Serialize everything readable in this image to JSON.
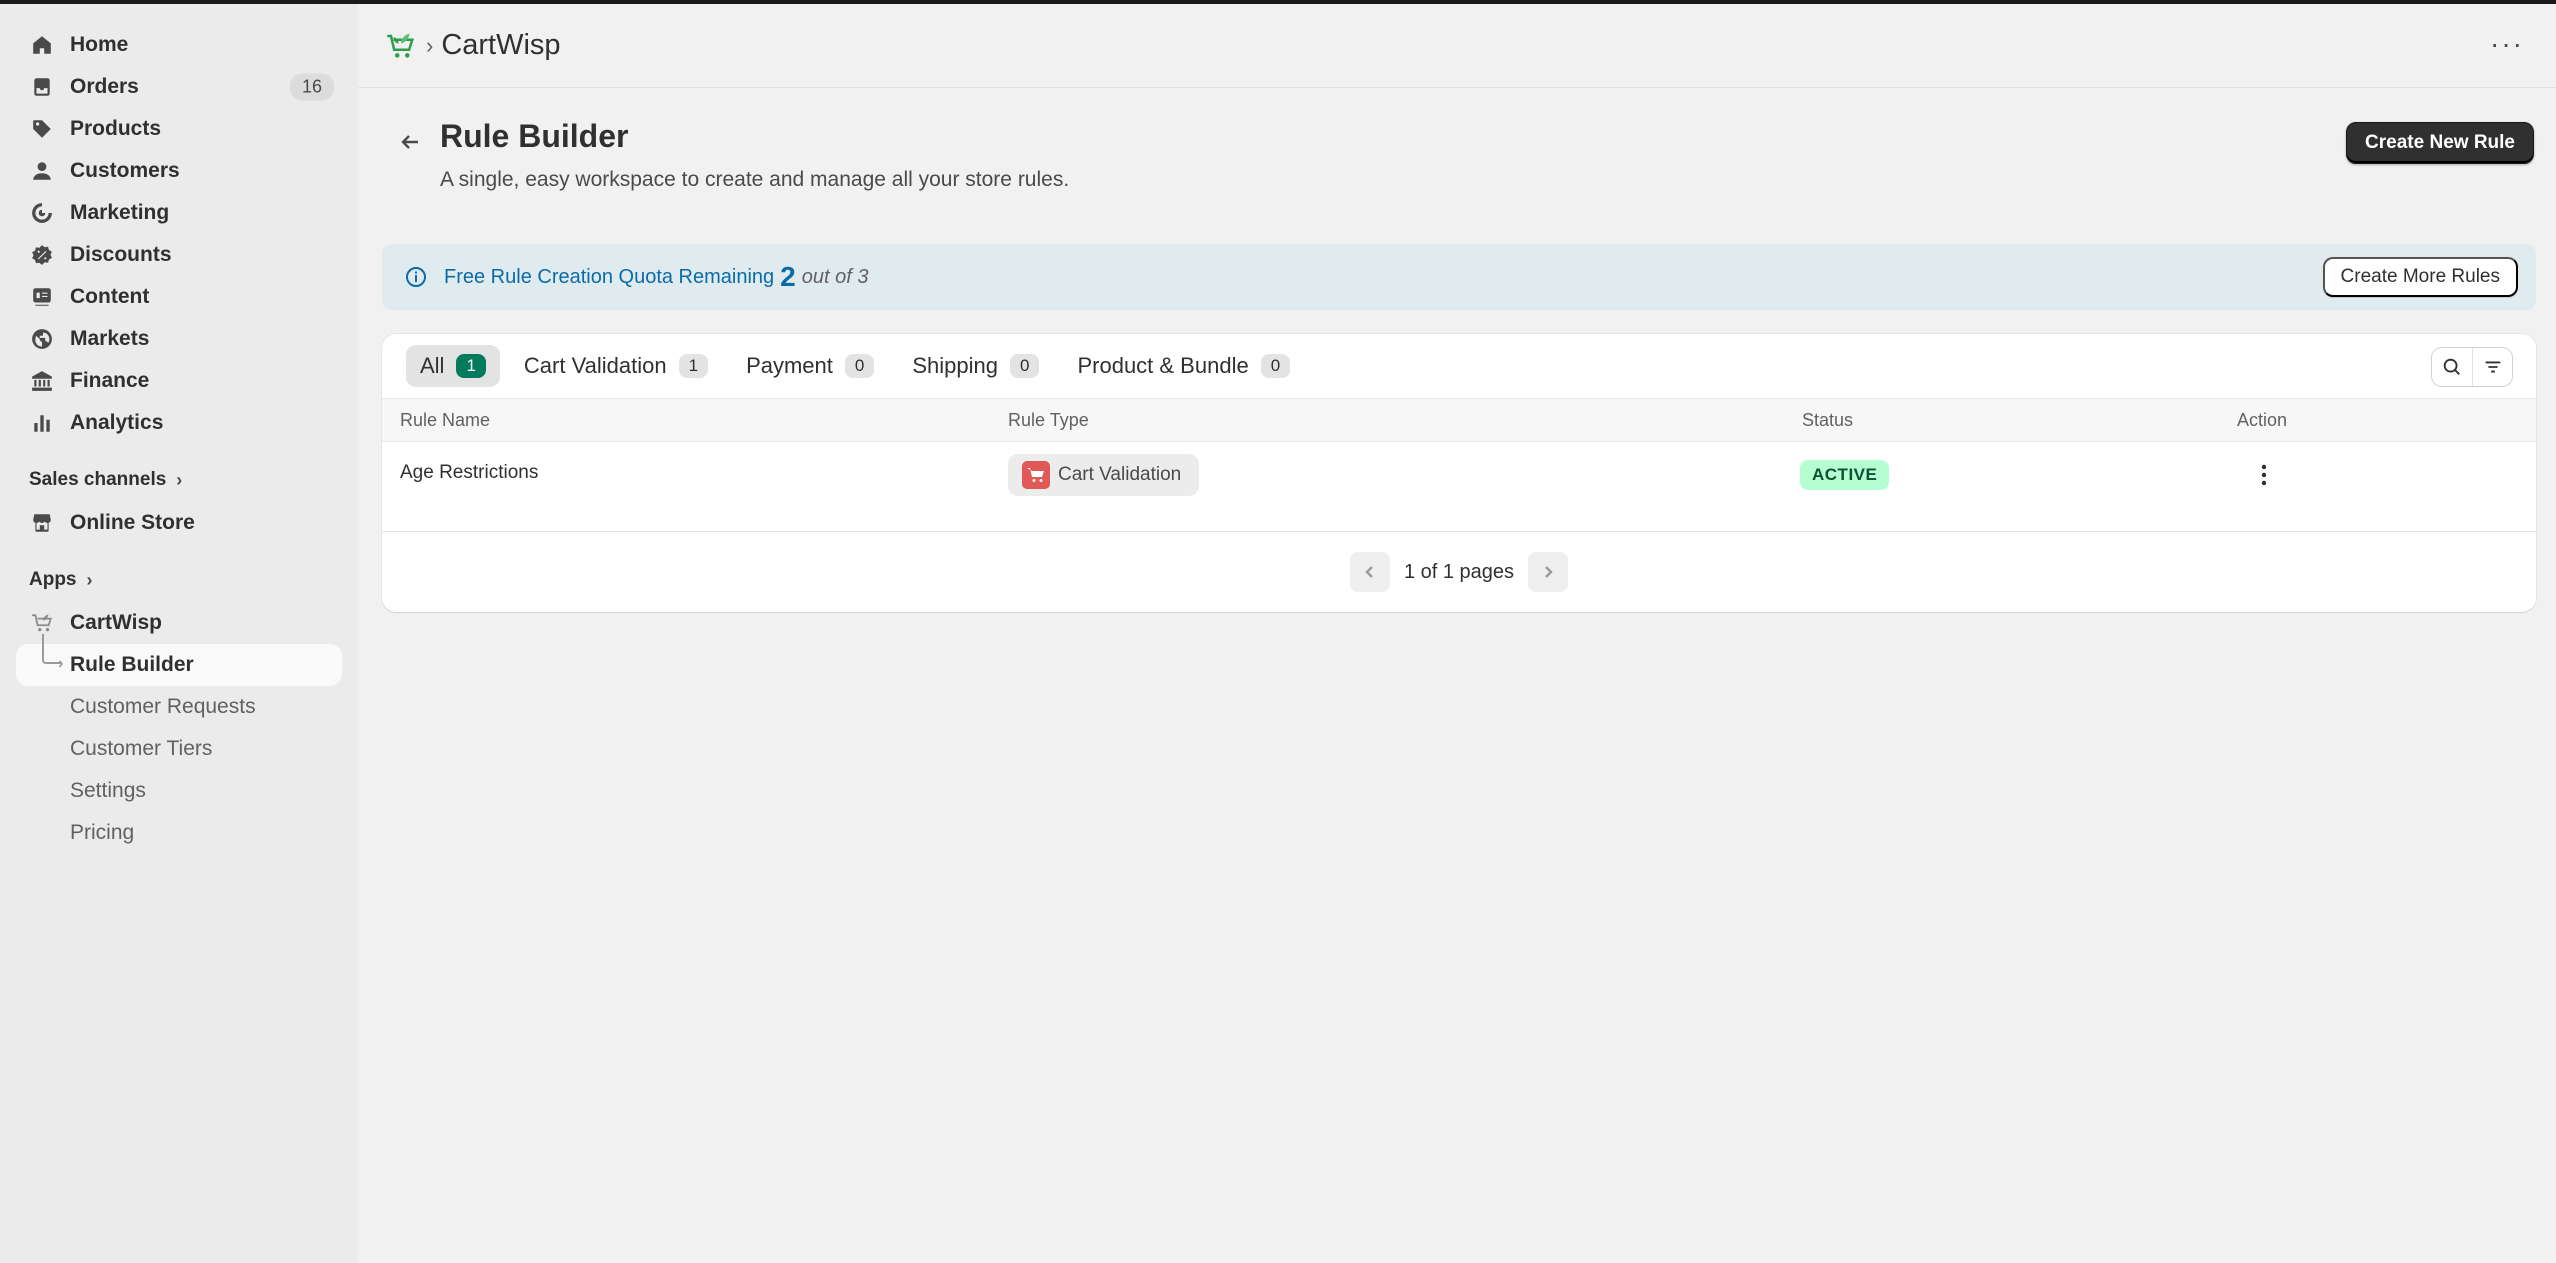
{
  "sidebar": {
    "nav": [
      {
        "label": "Home",
        "icon": "home-icon"
      },
      {
        "label": "Orders",
        "icon": "orders-icon",
        "badge": "16"
      },
      {
        "label": "Products",
        "icon": "tag-icon"
      },
      {
        "label": "Customers",
        "icon": "person-icon"
      },
      {
        "label": "Marketing",
        "icon": "target-icon"
      },
      {
        "label": "Discounts",
        "icon": "discount-icon"
      },
      {
        "label": "Content",
        "icon": "content-icon"
      },
      {
        "label": "Markets",
        "icon": "globe-icon"
      },
      {
        "label": "Finance",
        "icon": "bank-icon"
      },
      {
        "label": "Analytics",
        "icon": "bar-chart-icon"
      }
    ],
    "sales_channels_label": "Sales channels",
    "online_store_label": "Online Store",
    "apps_label": "Apps",
    "app_name": "CartWisp",
    "app_items": [
      "Rule Builder",
      "Customer Requests",
      "Customer Tiers",
      "Settings",
      "Pricing"
    ]
  },
  "header": {
    "app_title": "CartWisp"
  },
  "page": {
    "title": "Rule Builder",
    "subtitle": "A single, easy workspace to create and manage all your store rules.",
    "create_button": "Create New Rule"
  },
  "banner": {
    "text": "Free Rule Creation Quota Remaining",
    "remaining": "2",
    "suffix": "out of 3",
    "button": "Create More Rules"
  },
  "tabs": [
    {
      "label": "All",
      "count": "1"
    },
    {
      "label": "Cart Validation",
      "count": "1"
    },
    {
      "label": "Payment",
      "count": "0"
    },
    {
      "label": "Shipping",
      "count": "0"
    },
    {
      "label": "Product & Bundle",
      "count": "0"
    }
  ],
  "table": {
    "columns": [
      "Rule Name",
      "Rule Type",
      "Status",
      "Action"
    ],
    "rows": [
      {
        "name": "Age Restrictions",
        "type": "Cart Validation",
        "status": "ACTIVE"
      }
    ]
  },
  "pagination": {
    "text": "1 of 1 pages"
  },
  "colors": {
    "primary_button": "#303030",
    "active_tab_badge": "#047b5d",
    "status_active_bg": "#b4fed2",
    "banner_text": "#0b6ba8",
    "cart_icon_bg": "#e05858"
  }
}
